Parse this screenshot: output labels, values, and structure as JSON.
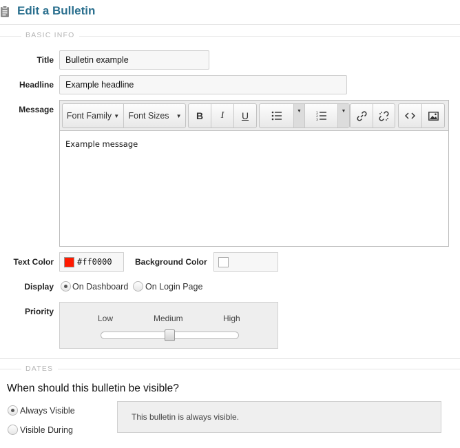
{
  "header": {
    "title": "Edit a Bulletin",
    "icon": "clipboard-icon"
  },
  "basic_info": {
    "section_label": "BASIC INFO",
    "title": {
      "label": "Title",
      "value": "Bulletin example"
    },
    "headline": {
      "label": "Headline",
      "value": "Example headline"
    },
    "message": {
      "label": "Message",
      "toolbar": {
        "font_family": "Font Family",
        "font_sizes": "Font Sizes",
        "bold": "B",
        "italic": "I",
        "underline": "U"
      },
      "body": "Example message"
    },
    "text_color": {
      "label": "Text Color",
      "value": "#ff0000",
      "swatch": "#ff1a00"
    },
    "background_color": {
      "label": "Background Color",
      "value": ""
    },
    "display": {
      "label": "Display",
      "options": [
        "On Dashboard",
        "On Login Page"
      ],
      "selected": "On Dashboard"
    },
    "priority": {
      "label": "Priority",
      "ticks": [
        "Low",
        "Medium",
        "High"
      ],
      "value": "Medium"
    }
  },
  "dates": {
    "section_label": "DATES",
    "question": "When should this bulletin be visible?",
    "options": [
      "Always Visible",
      "Visible During"
    ],
    "selected": "Always Visible",
    "info": "This bulletin is always visible."
  },
  "colors": {
    "accent": "#2a6f8e"
  }
}
